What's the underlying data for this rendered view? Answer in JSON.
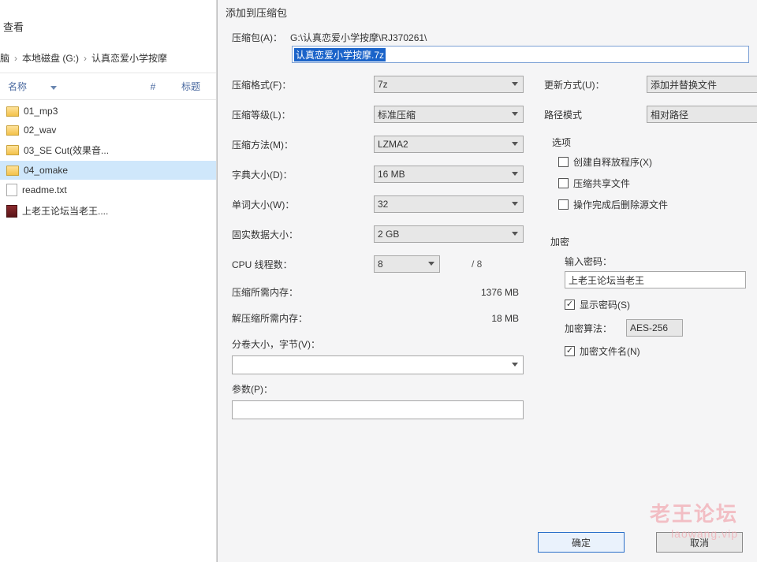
{
  "explorer": {
    "view_label": "查看",
    "breadcrumb": {
      "part1": "脑",
      "part2": "本地磁盘 (G:)",
      "part3": "认真恋爱小学按摩"
    },
    "headers": {
      "name": "名称",
      "num": "#",
      "title": "标题"
    },
    "items": [
      {
        "type": "folder",
        "label": "01_mp3"
      },
      {
        "type": "folder",
        "label": "02_wav"
      },
      {
        "type": "folder",
        "label": "03_SE Cut(效果音..."
      },
      {
        "type": "folder",
        "label": "04_omake",
        "selected": true
      },
      {
        "type": "file",
        "label": "readme.txt"
      },
      {
        "type": "archive",
        "label": "上老王论坛当老王...."
      }
    ]
  },
  "dialog": {
    "title": "添加到压缩包",
    "archive_label": "压缩包(A)：",
    "archive_path_prefix": "G:\\认真恋爱小学按摩\\RJ370261\\",
    "archive_filename_selected": "认真恋爱小学按摩.7z",
    "left": {
      "format_label": "压缩格式(F)：",
      "format_value": "7z",
      "level_label": "压缩等级(L)：",
      "level_value": "标准压缩",
      "method_label": "压缩方法(M)：",
      "method_value": "LZMA2",
      "dict_label": "字典大小(D)：",
      "dict_value": "16 MB",
      "word_label": "单词大小(W)：",
      "word_value": "32",
      "solid_label": "固实数据大小：",
      "solid_value": "2 GB",
      "cpu_label": "CPU 线程数：",
      "cpu_value": "8",
      "cpu_max": "/ 8",
      "compress_mem_label": "压缩所需内存：",
      "compress_mem_value": "1376 MB",
      "decompress_mem_label": "解压缩所需内存：",
      "decompress_mem_value": "18 MB",
      "split_label": "分卷大小，字节(V)：",
      "params_label": "参数(P)："
    },
    "right": {
      "update_label": "更新方式(U)：",
      "update_value": "添加并替换文件",
      "pathmode_label": "路径模式",
      "pathmode_value": "相对路径",
      "options_title": "选项",
      "opt_sfx": "创建自释放程序(X)",
      "opt_share": "压缩共享文件",
      "opt_delete": "操作完成后删除源文件",
      "encrypt_title": "加密",
      "pwd_label": "输入密码：",
      "pwd_value": "上老王论坛当老王",
      "show_pwd": "显示密码(S)",
      "algo_label": "加密算法：",
      "algo_value": "AES-256",
      "encrypt_names": "加密文件名(N)"
    },
    "buttons": {
      "ok": "确定",
      "cancel": "取消"
    }
  },
  "watermark": {
    "line1": "老王论坛",
    "line2": "laowang.vip"
  }
}
